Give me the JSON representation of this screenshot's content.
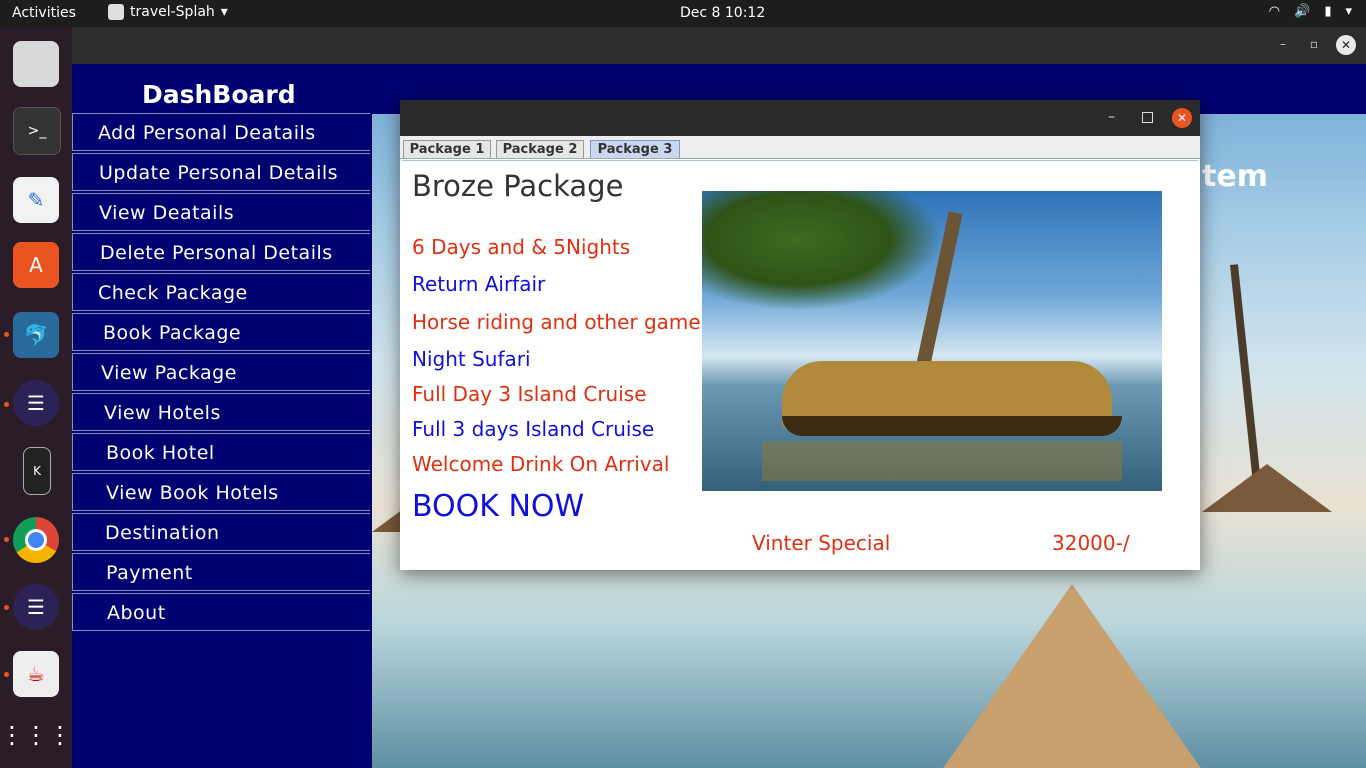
{
  "topbar": {
    "activities": "Activities",
    "app_name": "travel-Splah",
    "clock": "Dec 8  10:12"
  },
  "main_window": {
    "dashboard_title": "DashBoard",
    "menu": [
      "Add Personal Deatails",
      "Update Personal Details",
      "View Deatails",
      "Delete Personal Details",
      "Check Package",
      "Book Package",
      "View Package",
      "View Hotels",
      "Book Hotel",
      "View Book Hotels",
      "Destination",
      "Payment",
      "About"
    ],
    "background_title_fragment": "tem"
  },
  "dialog": {
    "tabs": [
      "Package 1",
      "Package 2",
      "Package 3"
    ],
    "active_tab": "Package 3",
    "package_title": "Broze Package",
    "features": [
      {
        "text": "6 Days and & 5Nights",
        "color": "#e03010"
      },
      {
        "text": "Return Airfair",
        "color": "#1010d8"
      },
      {
        "text": "Horse riding and other games",
        "color": "#e03010"
      },
      {
        "text": "Night Sufari",
        "color": "#1010d8"
      },
      {
        "text": "Full Day 3 Island Cruise",
        "color": "#e03010"
      },
      {
        "text": "Full 3 days Island Cruise",
        "color": "#1010d8"
      },
      {
        "text": "Welcome Drink On Arrival",
        "color": "#e03010"
      }
    ],
    "book_now": "BOOK NOW",
    "special": "Vinter Special",
    "price": "32000-/"
  },
  "colors": {
    "dashboard_bg": "#000070",
    "red_text": "#e03010",
    "blue_text": "#1010d8"
  },
  "icons": {
    "dock": [
      "files-icon",
      "terminal-icon",
      "text-editor-icon",
      "app-center-icon",
      "mysql-workbench-icon",
      "eclipse-icon",
      "kde-connect-icon",
      "chrome-icon",
      "eclipse-icon",
      "java-icon",
      "app-grid-icon"
    ]
  }
}
